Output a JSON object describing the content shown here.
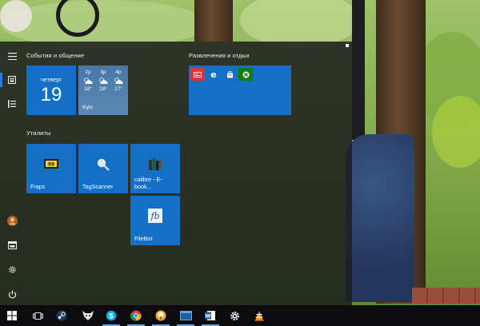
{
  "start_menu": {
    "groups": [
      {
        "title": "События и общение"
      },
      {
        "title": "Развлечения и отдых"
      },
      {
        "title": "Утилиты"
      }
    ],
    "calendar": {
      "day_name": "четверг",
      "day_number": "19"
    },
    "weather": {
      "city": "Kyiv",
      "forecast": [
        {
          "time": "2p",
          "temp": "18°"
        },
        {
          "time": "3p",
          "temp": "18°"
        },
        {
          "time": "4p",
          "temp": "17°"
        }
      ]
    },
    "utility_tiles": [
      {
        "label": "Fraps",
        "icon": "fraps-icon"
      },
      {
        "label": "TagScanner",
        "icon": "magnifier-icon"
      },
      {
        "label": "calibre - E-\nbook...",
        "icon": "books-icon"
      },
      {
        "label": "FileBot",
        "icon": "filebot-icon",
        "icon_text": "fb"
      }
    ],
    "entertainment_icons": [
      "news-icon",
      "edge-icon",
      "store-icon",
      "xbox-icon"
    ]
  },
  "rail": [
    "hamburger-icon",
    "tiles-view-icon",
    "all-apps-list-icon",
    "user-avatar",
    "explorer-icon",
    "settings-icon",
    "power-icon"
  ],
  "taskbar": {
    "items": [
      "start-icon",
      "task-view-icon",
      "steam-icon",
      "fox-app-icon",
      "skype-icon",
      "chrome-icon",
      "tree-app-icon",
      "window-app-icon",
      "word-icon",
      "settings-icon",
      "vlc-icon"
    ]
  },
  "colors": {
    "tile_blue": "#1470c6",
    "start_bg": "#1c1d1e",
    "taskbar_bg": "#0c0c0e"
  }
}
